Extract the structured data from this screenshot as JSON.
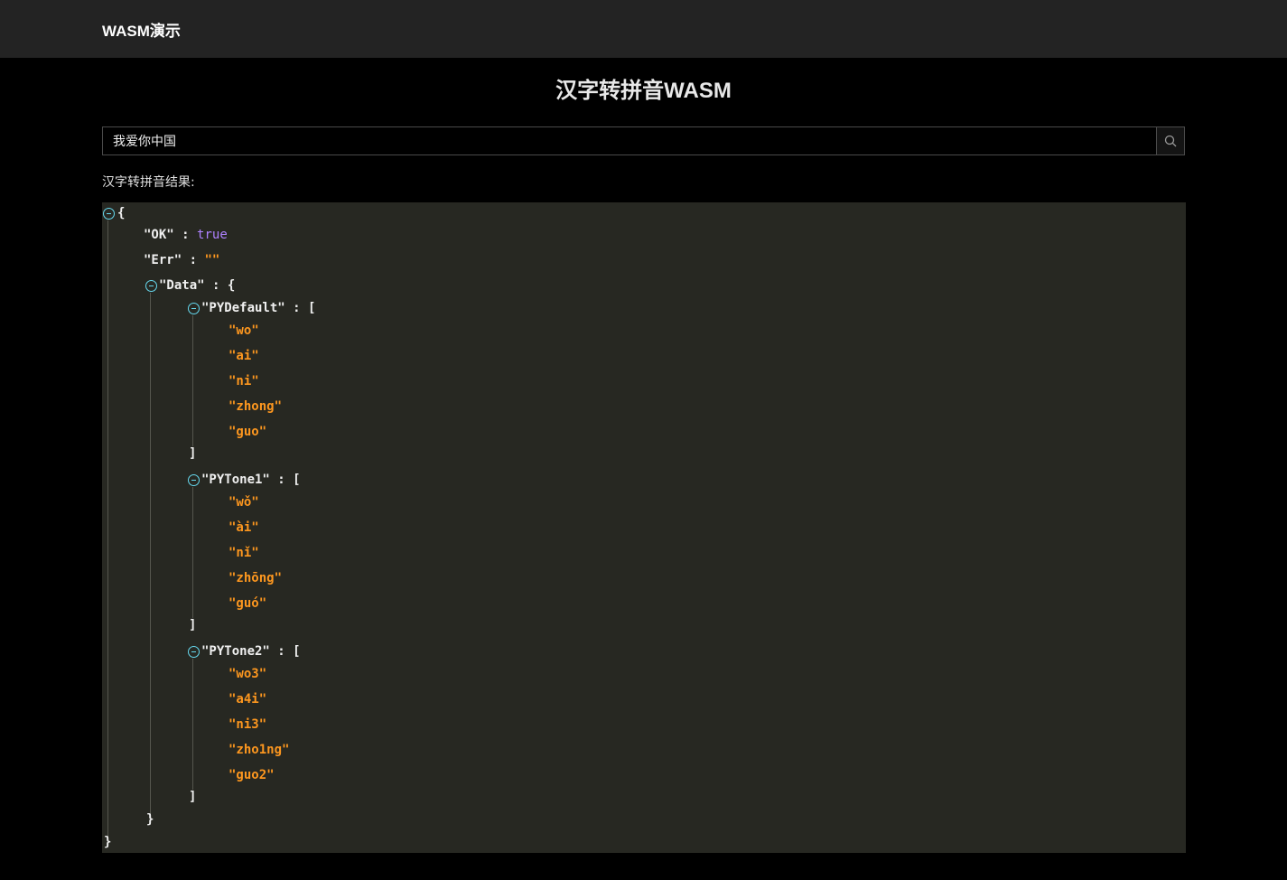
{
  "header": {
    "brand": "WASM演示"
  },
  "main": {
    "title": "汉字转拼音WASM",
    "search": {
      "value": "我爱你中国",
      "icon": "search-icon"
    },
    "result_label": "汉字转拼音结果:"
  },
  "json_view": {
    "open_brace": "{",
    "close_brace": "}",
    "ok_key": "\"OK\"",
    "ok_value": "true",
    "err_key": "\"Err\"",
    "err_value": "\"\"",
    "data_key": "\"Data\"",
    "colon": ":",
    "open_bracket": "[",
    "close_bracket": "]",
    "py_default": {
      "key": "\"PYDefault\"",
      "items": [
        "\"wo\"",
        "\"ai\"",
        "\"ni\"",
        "\"zhong\"",
        "\"guo\""
      ]
    },
    "py_tone1": {
      "key": "\"PYTone1\"",
      "items": [
        "\"wǒ\"",
        "\"ài\"",
        "\"nǐ\"",
        "\"zhōng\"",
        "\"guó\""
      ]
    },
    "py_tone2": {
      "key": "\"PYTone2\"",
      "items": [
        "\"wo3\"",
        "\"a4i\"",
        "\"ni3\"",
        "\"zho1ng\"",
        "\"guo2\""
      ]
    }
  },
  "colors": {
    "background": "#000000",
    "header": "#232323",
    "code_bg": "#272822",
    "string": "#fd971f",
    "boolean": "#ae81ff",
    "toggle": "#66d9ef"
  }
}
